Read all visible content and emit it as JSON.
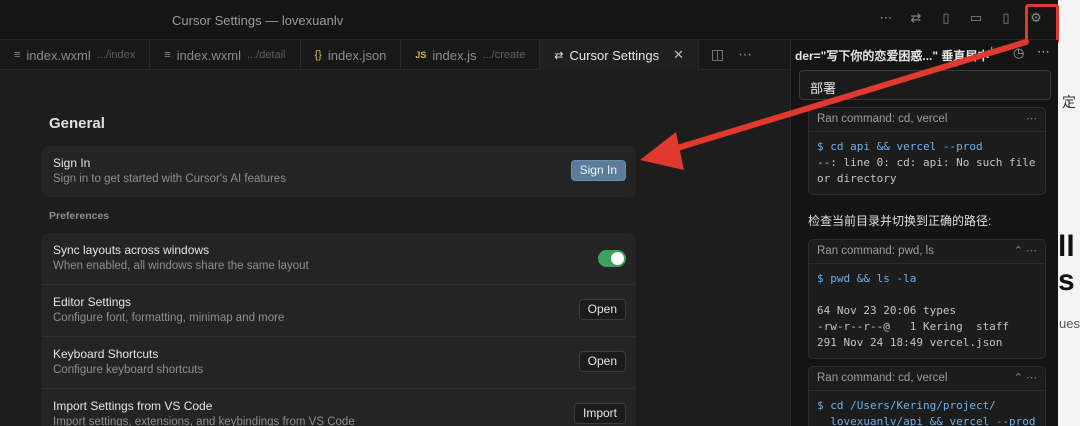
{
  "window": {
    "title": "Cursor Settings — lovexuanlv"
  },
  "tabs": [
    {
      "icon": "≡",
      "label": "index.wxml",
      "path": ".../index",
      "active": false
    },
    {
      "icon": "≡",
      "label": "index.wxml",
      "path": ".../detail",
      "active": false
    },
    {
      "icon": "{}",
      "label": "index.json",
      "path": "",
      "active": false
    },
    {
      "icon": "JS",
      "label": "index.js",
      "path": ".../create",
      "active": false
    },
    {
      "icon": "⇄",
      "label": "Cursor Settings",
      "path": "",
      "active": true
    }
  ],
  "settings": {
    "general_title": "General",
    "signin": {
      "title": "Sign In",
      "desc": "Sign in to get started with Cursor's AI features",
      "button": "Sign In"
    },
    "preferences_label": "Preferences",
    "rows": [
      {
        "title": "Sync layouts across windows",
        "desc": "When enabled, all windows share the same layout",
        "control": "toggle",
        "on": true
      },
      {
        "title": "Editor Settings",
        "desc": "Configure font, formatting, minimap and more",
        "control": "button",
        "button": "Open"
      },
      {
        "title": "Keyboard Shortcuts",
        "desc": "Configure keyboard shortcuts",
        "control": "button",
        "button": "Open"
      },
      {
        "title": "Import Settings from VS Code",
        "desc": "Import settings, extensions, and keybindings from VS Code",
        "control": "button",
        "button": "Import"
      }
    ]
  },
  "chat": {
    "header": "der=\"写下你的恋爱困惑...\" 垂直居中",
    "deploy_label": "部署",
    "commands": [
      {
        "head": "Ran command: cd, vercel",
        "lines": [
          "$ cd api && vercel --prod",
          "--: line 0: cd: api: No such file",
          "or directory"
        ]
      },
      {
        "head": "Ran command: pwd, ls",
        "lines": [
          "$ pwd && ls -la",
          "",
          "64 Nov 23 20:06 types",
          "-rw-r--r--@   1 Kering  staff",
          "291 Nov 24 18:49 vercel.json"
        ]
      },
      {
        "head": "Ran command: cd, vercel",
        "lines": [
          "$ cd /Users/Kering/project/",
          "  lovexuanlv/api && vercel --prod"
        ]
      }
    ],
    "text": "检查当前目录并切换到正确的路径:"
  },
  "background": {
    "right_char": "定",
    "right_big": "ll s",
    "right_small": "ues"
  },
  "colors": {
    "toggle_on": "#3fa15c",
    "highlight": "#e03a2f",
    "primary_button": "#5b7c98"
  }
}
